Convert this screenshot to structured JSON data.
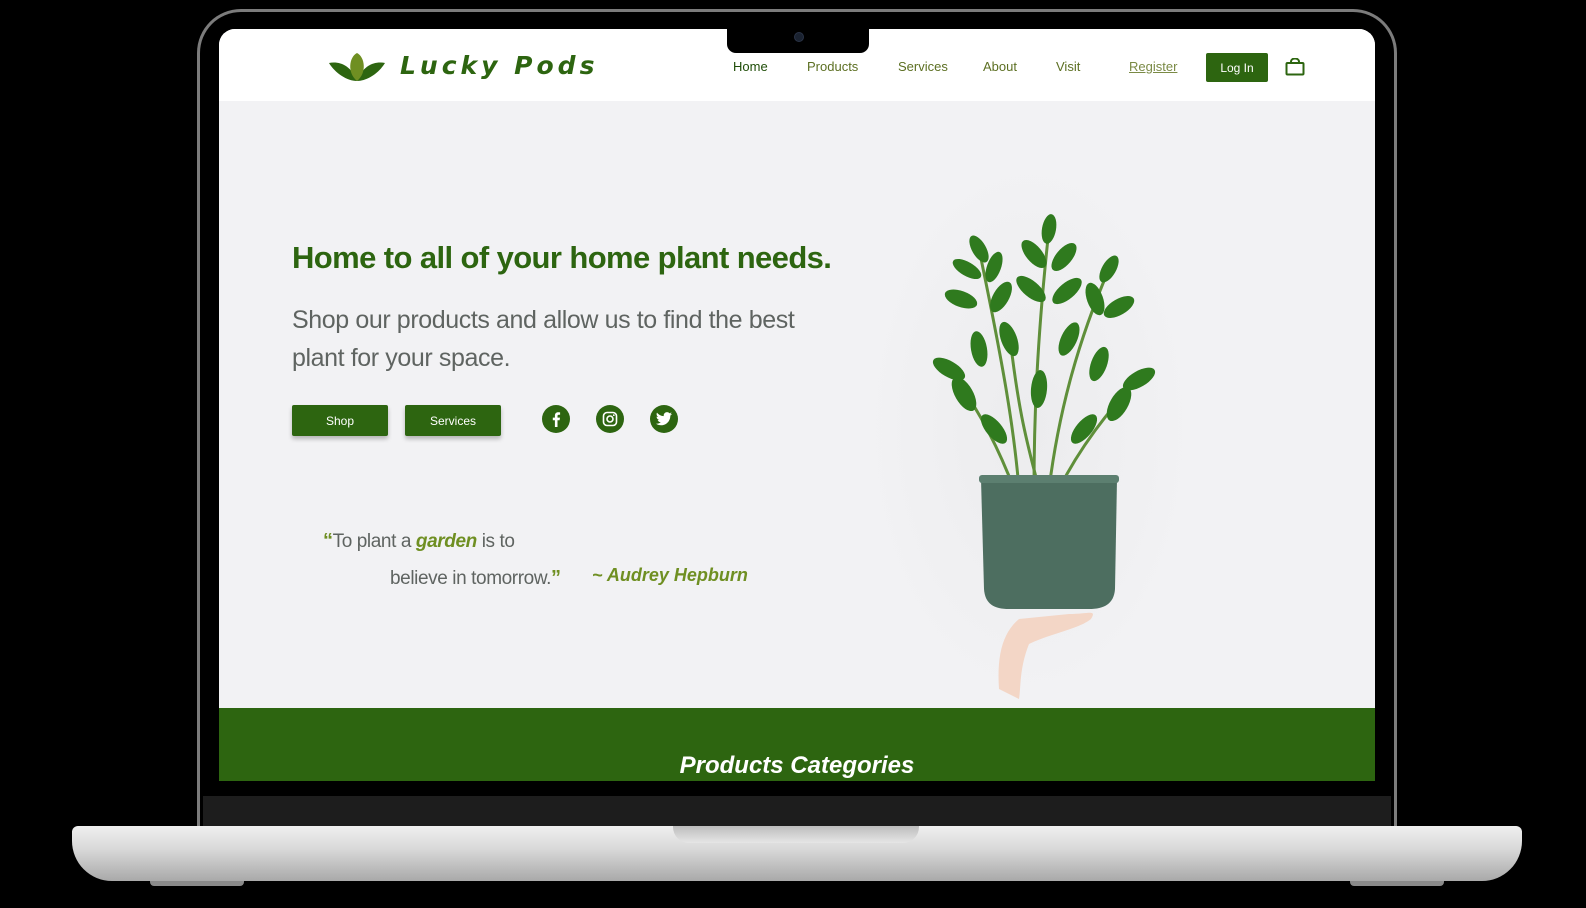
{
  "brand": {
    "name": "Lucky Pods"
  },
  "nav": {
    "links": [
      "Home",
      "Products",
      "Services",
      "About",
      "Visit"
    ],
    "register": "Register",
    "login": "Log In"
  },
  "hero": {
    "title": "Home to all of your home plant needs.",
    "subtitle": "Shop our products and allow us to find the best plant for your space.",
    "shop_button": "Shop",
    "services_button": "Services"
  },
  "social": [
    "facebook-icon",
    "instagram-icon",
    "twitter-icon"
  ],
  "quote": {
    "open_mark": "“",
    "part1": "To plant a ",
    "highlight": "garden",
    "part2": " is to",
    "line2": "believe in tomorrow.",
    "close_mark": "”",
    "author": "~ Audrey Hepburn"
  },
  "categories": {
    "title": "Products Categories"
  },
  "colors": {
    "brand_green": "#2d6510",
    "accent_olive": "#6f8f22",
    "text_gray": "#5f6461",
    "hero_bg": "#f2f2f4"
  }
}
